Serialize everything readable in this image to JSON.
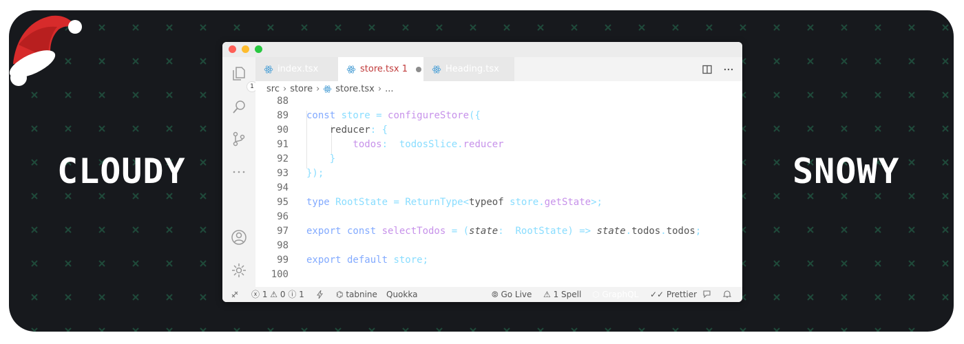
{
  "banner": {
    "left_word": "CLOUDY",
    "right_word": "SNOWY",
    "background_color": "#17191d",
    "pattern_icon": "x-cross-icon",
    "decoration_icon": "santa-hat-icon"
  },
  "window": {
    "traffic_lights": [
      "#ff5f57",
      "#febc2e",
      "#28c840"
    ],
    "activity_bar": {
      "items": [
        "files-icon",
        "search-icon",
        "source-control-icon",
        "more-icon",
        "account-icon",
        "settings-gear-icon"
      ],
      "explorer_badge": "1"
    },
    "tabs": [
      {
        "label": "index.tsx",
        "icon": "react-icon",
        "active": false
      },
      {
        "label": "store.tsx 1",
        "icon": "react-icon",
        "active": true,
        "modified": true
      },
      {
        "label": "Heading.tsx",
        "icon": "react-icon",
        "active": false
      }
    ],
    "tab_actions": [
      "split-editor-icon",
      "more-actions-icon"
    ],
    "breadcrumb": {
      "parts": [
        "src",
        "store",
        "store.tsx",
        "..."
      ]
    },
    "code_lines": [
      {
        "n": "88",
        "tokens": []
      },
      {
        "n": "89",
        "tokens": [
          {
            "t": "const ",
            "c": "#82aaff"
          },
          {
            "t": "store",
            "c": "#89ddff"
          },
          {
            "t": " = ",
            "c": "#89ddff"
          },
          {
            "t": "configureStore",
            "c": "#c792ea"
          },
          {
            "t": "({",
            "c": "#89ddff"
          }
        ]
      },
      {
        "n": "90",
        "tokens": [
          {
            "t": "    reducer",
            "c": "#555555"
          },
          {
            "t": ":",
            "c": "#89ddff"
          },
          {
            "t": " {",
            "c": "#89ddff"
          }
        ]
      },
      {
        "n": "91",
        "tokens": [
          {
            "t": "        todos",
            "c": "#c792ea"
          },
          {
            "t": ":",
            "c": "#89ddff"
          },
          {
            "t": "  ",
            "c": "#555555"
          },
          {
            "t": "todosSlice",
            "c": "#89ddff"
          },
          {
            "t": ".",
            "c": "#89ddff"
          },
          {
            "t": "reducer",
            "c": "#c792ea"
          }
        ]
      },
      {
        "n": "92",
        "tokens": [
          {
            "t": "    }",
            "c": "#89ddff"
          }
        ]
      },
      {
        "n": "93",
        "tokens": [
          {
            "t": "});",
            "c": "#89ddff"
          }
        ]
      },
      {
        "n": "94",
        "tokens": []
      },
      {
        "n": "95",
        "tokens": [
          {
            "t": "type ",
            "c": "#82aaff"
          },
          {
            "t": "RootState",
            "c": "#89ddff"
          },
          {
            "t": " = ",
            "c": "#89ddff"
          },
          {
            "t": "ReturnType",
            "c": "#89ddff"
          },
          {
            "t": "<",
            "c": "#89ddff"
          },
          {
            "t": "typeof ",
            "c": "#555555"
          },
          {
            "t": "store",
            "c": "#89ddff"
          },
          {
            "t": ".",
            "c": "#89ddff"
          },
          {
            "t": "getState",
            "c": "#c792ea"
          },
          {
            "t": ">;",
            "c": "#89ddff"
          }
        ]
      },
      {
        "n": "96",
        "tokens": []
      },
      {
        "n": "97",
        "tokens": [
          {
            "t": "export const ",
            "c": "#82aaff"
          },
          {
            "t": "selectTodos",
            "c": "#c792ea"
          },
          {
            "t": " = ",
            "c": "#89ddff"
          },
          {
            "t": "(",
            "c": "#89ddff"
          },
          {
            "t": "state",
            "c": "#555555",
            "i": true
          },
          {
            "t": ": ",
            "c": "#89ddff"
          },
          {
            "t": " RootState",
            "c": "#89ddff"
          },
          {
            "t": ") => ",
            "c": "#89ddff"
          },
          {
            "t": "state",
            "c": "#555555",
            "i": true
          },
          {
            "t": ".",
            "c": "#89ddff"
          },
          {
            "t": "todos",
            "c": "#555555"
          },
          {
            "t": ".",
            "c": "#89ddff"
          },
          {
            "t": "todos",
            "c": "#555555"
          },
          {
            "t": ";",
            "c": "#89ddff"
          }
        ]
      },
      {
        "n": "98",
        "tokens": []
      },
      {
        "n": "99",
        "tokens": [
          {
            "t": "export default ",
            "c": "#82aaff"
          },
          {
            "t": "store",
            "c": "#89ddff"
          },
          {
            "t": ";",
            "c": "#89ddff"
          }
        ]
      },
      {
        "n": "100",
        "tokens": []
      }
    ],
    "statusbar": {
      "remote_icon": "remote-icon",
      "problems": "1 ⚠ 0 ⓘ 1",
      "lightning_icon": "lightning-icon",
      "tabnine": "tabnine",
      "quokka": "Quokka",
      "go_live": "Go Live",
      "spell": "1 Spell",
      "graphql": "GraphQL",
      "prettier": "Prettier",
      "feedback_icon": "feedback-icon",
      "bell_icon": "bell-icon"
    }
  }
}
